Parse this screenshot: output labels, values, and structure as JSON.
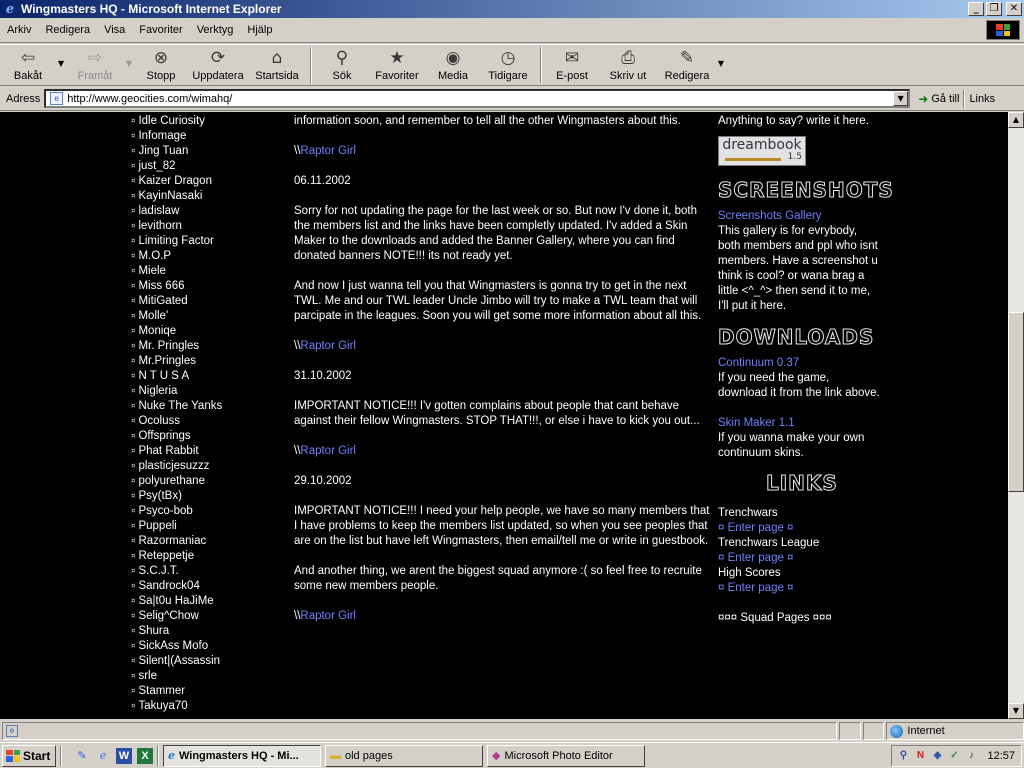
{
  "window": {
    "title": "Wingmasters HQ - Microsoft Internet Explorer",
    "minimize": "_",
    "maximize": "❐",
    "close": "✕"
  },
  "menu": [
    "Arkiv",
    "Redigera",
    "Visa",
    "Favoriter",
    "Verktyg",
    "Hjälp"
  ],
  "toolbar": {
    "back": "Bakåt",
    "forward": "Framåt",
    "stop": "Stopp",
    "refresh": "Uppdatera",
    "home": "Startsida",
    "search": "Sök",
    "favorites": "Favoriter",
    "media": "Media",
    "history": "Tidigare",
    "mail": "E-post",
    "print": "Skriv ut",
    "edit": "Redigera"
  },
  "address": {
    "label": "Adress",
    "url": "http://www.geocities.com/wimahq/",
    "go": "Gå till",
    "links": "Links"
  },
  "members": [
    "Idle Curiosity",
    "Infomage",
    "Jing Tuan",
    "just_82",
    "Kaizer Dragon",
    "KayinNasaki",
    "ladislaw",
    "levithorn",
    "Limiting Factor",
    "M.O.P",
    "Miele",
    "Miss 666",
    "MitiGated",
    "Molle'",
    "Moniqe",
    "Mr. Pringles",
    "Mr.Pringles",
    "N T U S A",
    "Nigleria",
    "Nuke The Yanks",
    "Ocoluss",
    "Offsprings",
    "Phat Rabbit",
    "plasticjesuzzz",
    "polyurethane",
    "Psy(tBx)",
    "Psyco-bob",
    "Puppeli",
    "Razormaniac",
    "Reteppetje",
    "S.C.J.T.",
    "Sandrock04",
    "Sa|t0u HaJiMe",
    "Selig^Chow",
    "Shura",
    "SickAss Mofo",
    "Silent|(Assassin",
    "srle",
    "Stammer",
    "Takuya70"
  ],
  "news": {
    "intro": "information soon, and remember to tell all the other Wingmasters about this.",
    "signature": "Raptor Girl",
    "signature_prefix": "\\\\",
    "posts": [
      {
        "date": "06.11.2002",
        "paragraphs": [
          "Sorry for not updating the page for the last week or so. But now I'v done it, both the members list and the links have been completly updated. I'v added a Skin Maker to the downloads and added the Banner Gallery, where you can find donated banners NOTE!!! its not ready yet.",
          "And now I just wanna tell you that Wingmasters is gonna try to get in the next TWL. Me and our TWL leader Uncle Jimbo will try to make a TWL team that will parcipate in the leagues. Soon you will get some more information about all this."
        ]
      },
      {
        "date": "31.10.2002",
        "paragraphs": [
          "IMPORTANT NOTICE!!! I'v gotten complains about people that cant behave against their fellow Wingmasters. STOP THAT!!!, or else i have to kick you out..."
        ]
      },
      {
        "date": "29.10.2002",
        "paragraphs": [
          "IMPORTANT NOTICE!!! I need your help people, we have so many members that I have problems to keep the members list updated, so when you see peoples that are on the list but have left Wingmasters, then email/tell me or write in guestbook.",
          "And another thing, we arent the biggest squad anymore :( so feel free to recruite some new members people."
        ]
      }
    ]
  },
  "sidebar": {
    "guestbook_text": "Anything to say? write it here.",
    "dreambook_label": "dreambook",
    "dreambook_version": "1.5",
    "screenshots_header": "SCREENSHOTS",
    "screenshots_link": "Screenshots Gallery",
    "screenshots_text": "This gallery is for evrybody, both members and ppl who isnt members. Have a screenshot u think is cool? or wana brag a little <^_^> then send it to me, I'll put it here.",
    "downloads_header": "DOWNLOADS",
    "dl1_link": "Continuum 0.37",
    "dl1_text": "If you need the game, download it from the link above.",
    "dl2_link": "Skin Maker 1.1",
    "dl2_text": "If you wanna make your own continuum skins.",
    "links_header": "LINKS",
    "links": [
      {
        "name": "Trenchwars",
        "enter": "¤ Enter page ¤"
      },
      {
        "name": "Trenchwars League",
        "enter": "¤ Enter page ¤"
      },
      {
        "name": "High Scores",
        "enter": "¤ Enter page ¤"
      }
    ],
    "squad_pages": "¤¤¤ Squad Pages ¤¤¤"
  },
  "status": {
    "zone": "Internet"
  },
  "taskbar": {
    "start": "Start",
    "tasks": [
      "Wingmasters HQ - Mi...",
      "old pages",
      "Microsoft Photo Editor"
    ],
    "clock": "12:57"
  },
  "colors": {
    "link": "#6f80ff",
    "titlebar": "#0a246a",
    "content_bg": "#000000"
  }
}
